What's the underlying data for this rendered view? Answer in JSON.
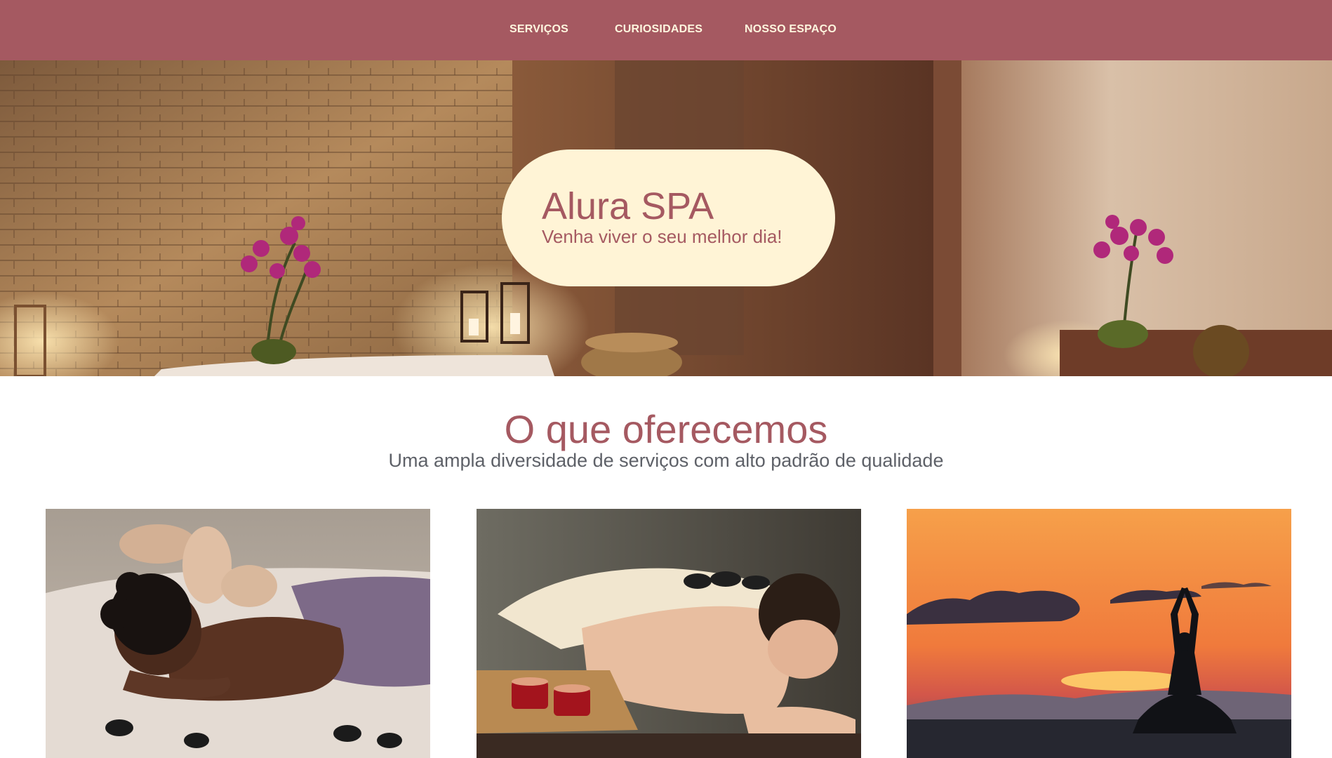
{
  "nav": {
    "items": [
      {
        "label": "SERVIÇOS"
      },
      {
        "label": "CURIOSIDADES"
      },
      {
        "label": "NOSSO ESPAÇO"
      }
    ]
  },
  "hero": {
    "title": "Alura SPA",
    "subtitle": "Venha viver o seu melhor dia!"
  },
  "services": {
    "heading": "O que oferecemos",
    "subheading": "Uma ampla diversidade de serviços com alto padrão de qualidade",
    "cards": [
      {
        "image": "massage-woman-photo"
      },
      {
        "image": "hot-stone-massage-photo"
      },
      {
        "image": "yoga-sunset-photo"
      }
    ]
  },
  "colors": {
    "brand": "#a55961",
    "cream": "#fff4d6",
    "nav_text": "#fff7df",
    "subtitle_gray": "#5e6168"
  }
}
